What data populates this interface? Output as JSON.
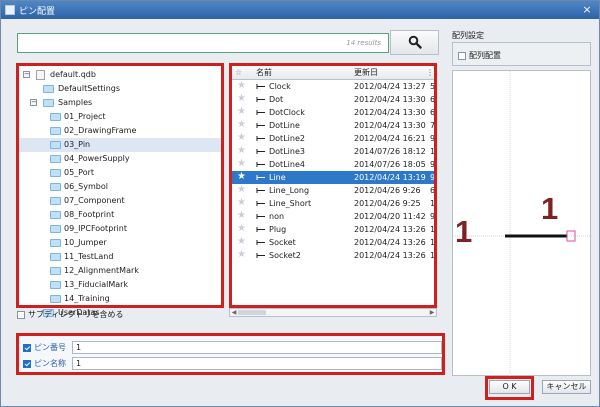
{
  "window": {
    "title": "ピン配置",
    "close": "×"
  },
  "search": {
    "value": "",
    "results": "14 results"
  },
  "tree": {
    "items": [
      {
        "label": "default.qdb",
        "type": "database"
      },
      {
        "label": "DefaultSettings",
        "type": "folder"
      },
      {
        "label": "Samples",
        "type": "folder"
      },
      {
        "label": "01_Project",
        "type": "folder"
      },
      {
        "label": "02_DrawingFrame",
        "type": "folder"
      },
      {
        "label": "03_Pin",
        "type": "folder",
        "selected": true
      },
      {
        "label": "04_PowerSupply",
        "type": "folder"
      },
      {
        "label": "05_Port",
        "type": "folder"
      },
      {
        "label": "06_Symbol",
        "type": "folder"
      },
      {
        "label": "07_Component",
        "type": "folder"
      },
      {
        "label": "08_Footprint",
        "type": "folder"
      },
      {
        "label": "09_IPCFootprint",
        "type": "folder"
      },
      {
        "label": "10_Jumper",
        "type": "folder"
      },
      {
        "label": "11_TestLand",
        "type": "folder"
      },
      {
        "label": "12_AlignmentMark",
        "type": "folder"
      },
      {
        "label": "13_FiducialMark",
        "type": "folder"
      },
      {
        "label": "14_Training",
        "type": "folder"
      },
      {
        "label": "UserDatas",
        "type": "folder"
      }
    ]
  },
  "subdir": {
    "label": "サブディレクトリを含める",
    "checked": false
  },
  "list": {
    "headers": {
      "star": "☆",
      "name": "名前",
      "date": "更新日",
      "extra": ""
    },
    "rows": [
      {
        "name": "Clock",
        "date": "2012/04/24 13:27",
        "extra": "5"
      },
      {
        "name": "Dot",
        "date": "2012/04/24 13:30",
        "extra": "6"
      },
      {
        "name": "DotClock",
        "date": "2012/04/24 13:30",
        "extra": "6"
      },
      {
        "name": "DotLine",
        "date": "2012/04/24 13:30",
        "extra": "7"
      },
      {
        "name": "DotLine2",
        "date": "2012/04/24 16:21",
        "extra": "9"
      },
      {
        "name": "DotLine3",
        "date": "2014/07/26 18:12",
        "extra": "1"
      },
      {
        "name": "DotLine4",
        "date": "2014/07/26 18:05",
        "extra": "9"
      },
      {
        "name": "Line",
        "date": "2012/04/24 13:19",
        "extra": "9",
        "selected": true
      },
      {
        "name": "Line_Long",
        "date": "2012/04/26 9:26",
        "extra": "6"
      },
      {
        "name": "Line_Short",
        "date": "2012/04/26 9:25",
        "extra": "1"
      },
      {
        "name": "non",
        "date": "2012/04/20 11:42",
        "extra": "9"
      },
      {
        "name": "Plug",
        "date": "2012/04/24 13:26",
        "extra": "1"
      },
      {
        "name": "Socket",
        "date": "2012/04/24 13:26",
        "extra": "1"
      },
      {
        "name": "Socket2",
        "date": "2012/04/24 13:26",
        "extra": "1"
      }
    ]
  },
  "settings": {
    "title": "配列設定",
    "option": "配列配置",
    "checked": false
  },
  "preview": {
    "pin_number": "1",
    "pin_name": "1"
  },
  "pins": {
    "number_label": "ピン番号",
    "number_value": "1",
    "name_label": "ピン名称",
    "name_value": "1"
  },
  "buttons": {
    "ok": "O K",
    "cancel": "キャンセル"
  },
  "colors": {
    "accent": "#2d78c9",
    "highlight": "#cf2020"
  }
}
